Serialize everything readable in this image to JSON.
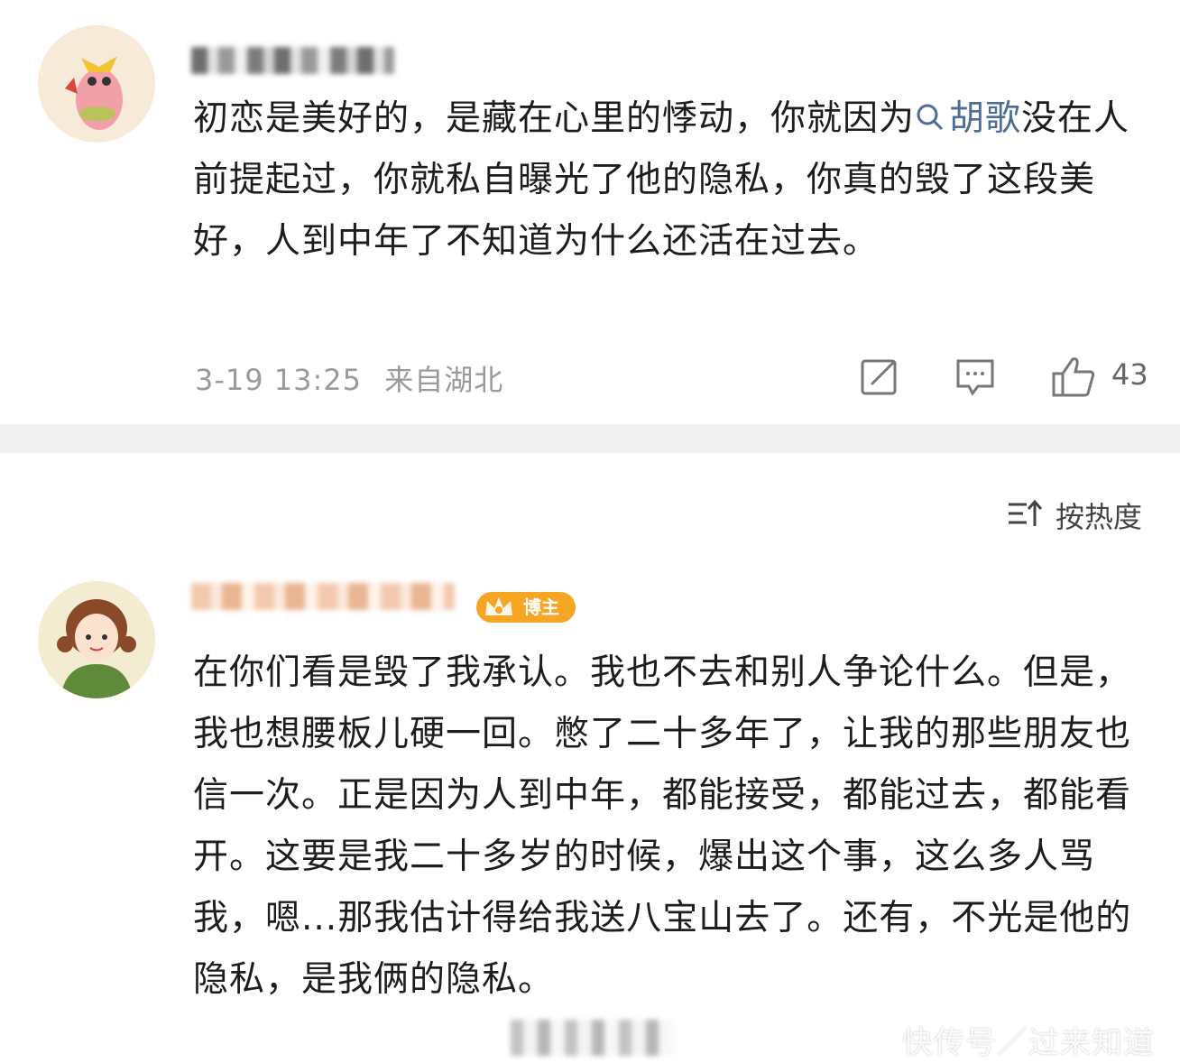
{
  "comment1": {
    "text_before_link": "初恋是美好的，是藏在心里的悸动，你就因为",
    "link_text": "胡歌",
    "text_after_link": "没在人前提起过，你就私自曝光了他的隐私，你真的毁了这段美好，人到中年了不知道为什么还活在过去。",
    "timestamp": "3-19 13:25",
    "location": "来自湖北",
    "like_count": "43",
    "icons": [
      "forward-icon",
      "reply-icon",
      "like-icon",
      "search-icon"
    ]
  },
  "sort": {
    "label": "按热度",
    "icon": "sort-icon"
  },
  "comment2": {
    "badge_label": "博主",
    "text": "在你们看是毁了我承认。我也不去和别人争论什么。但是，我也想腰板儿硬一回。憋了二十多年了，让我的那些朋友也信一次。正是因为人到中年，都能接受，都能过去，都能看开。这要是我二十多岁的时候，爆出这个事，这么多人骂我，嗯...那我估计得给我送八宝山去了。还有，不光是他的隐私，是我俩的隐私。"
  },
  "watermark": "快传号／过来知道",
  "colors": {
    "link": "#4b6d98",
    "badge": "#f6a623",
    "separator": "#f1f1f2",
    "meta": "#9a9a9a"
  }
}
